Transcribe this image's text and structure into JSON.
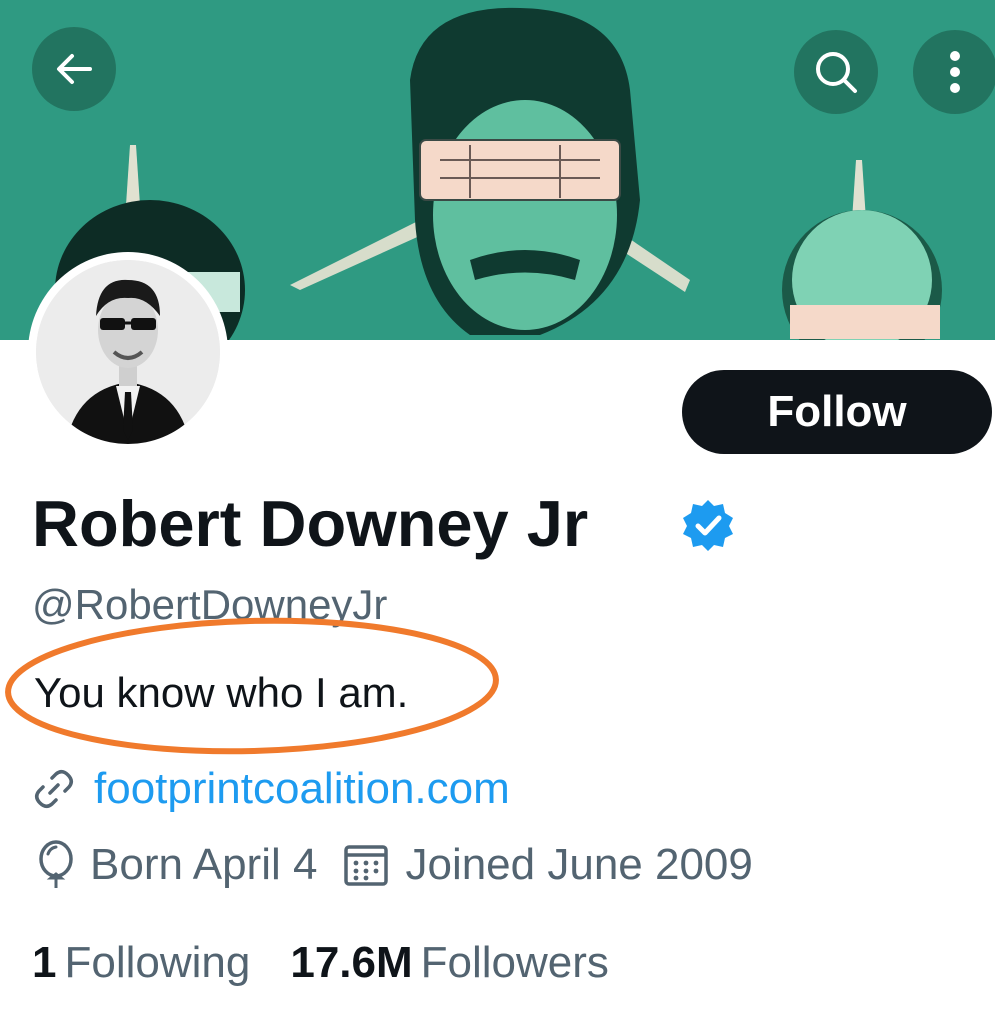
{
  "header": {
    "back_icon": "arrow-left-icon",
    "search_icon": "search-icon",
    "more_icon": "more-vertical-icon",
    "banner_color": "#2f9a82"
  },
  "profile": {
    "display_name": "Robert Downey Jr",
    "verified": true,
    "verified_color": "#1d9bf0",
    "handle": "@RobertDowneyJr",
    "bio": "You know who I am.",
    "website": "footprintcoalition.com",
    "birthday": "Born April 4",
    "joined": "Joined June 2009"
  },
  "actions": {
    "follow_label": "Follow"
  },
  "stats": {
    "following_count": "1",
    "following_label": "Following",
    "followers_count": "17.6M",
    "followers_label": "Followers"
  },
  "annotation": {
    "color": "#f07a2c"
  }
}
